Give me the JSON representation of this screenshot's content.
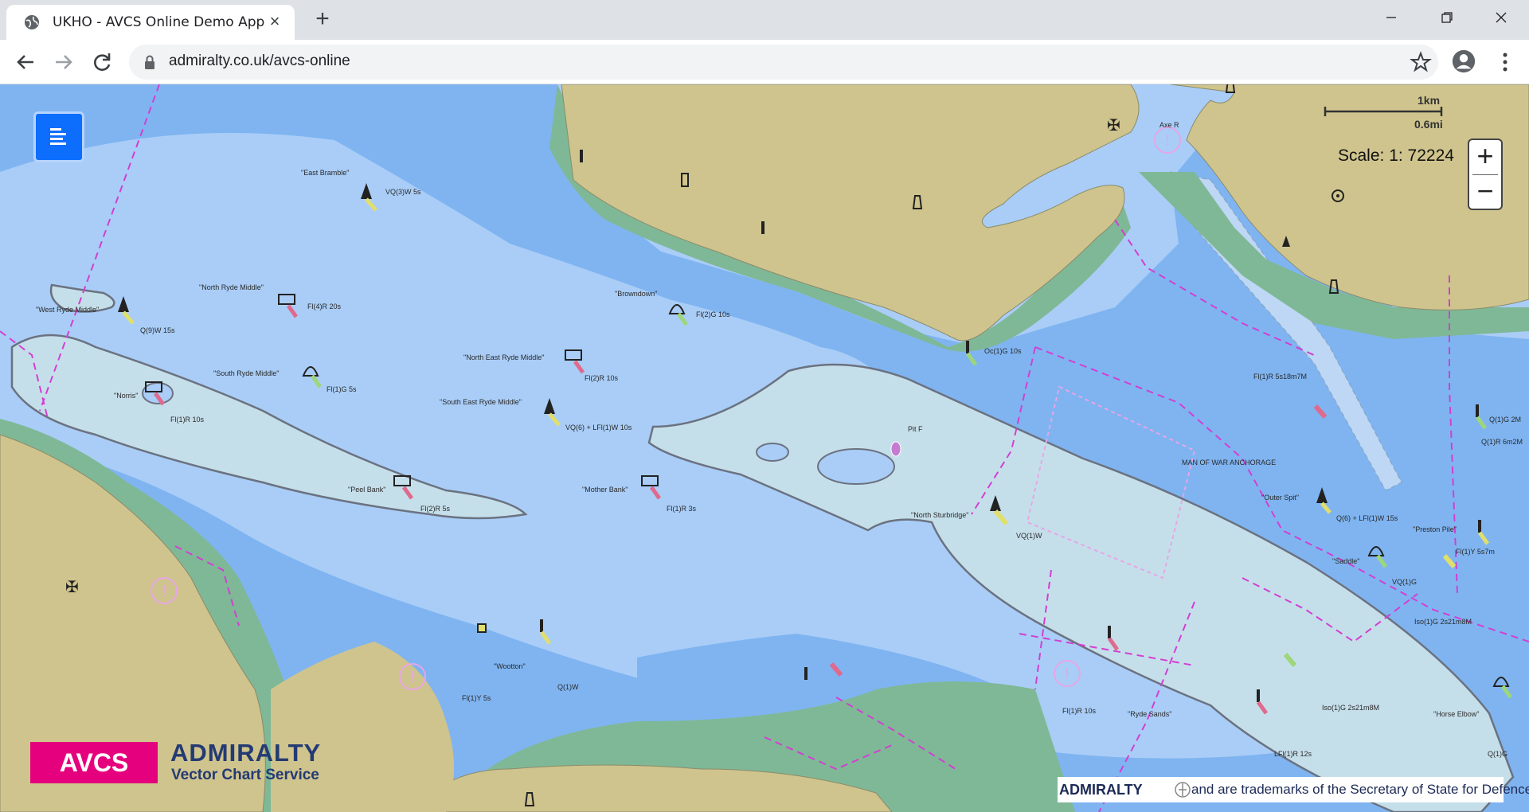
{
  "browser": {
    "tab_title": "UKHO - AVCS Online Demo App",
    "new_tab_label": "+",
    "url": "admiralty.co.uk/avcs-online"
  },
  "map": {
    "scale_text": "Scale: 1: 72224",
    "scalebar_km": "1km",
    "scalebar_mi": "0.6mi",
    "zoom_in_label": "+",
    "zoom_out_label": "−",
    "colors": {
      "deep_water": "#a9cdf7",
      "shallow_water": "#7fb4f1",
      "drying_bank": "#c5dfea",
      "land": "#cfc48d",
      "intertidal": "#7fb896",
      "magenta_boundary": "#d23fd2",
      "red_light": "#e06a8d",
      "green_light": "#9ed67a",
      "yellow_light": "#e0df6c"
    },
    "place_labels": [
      "\"East Bramble\"",
      "VQ(3)W 5s",
      "\"North Ryde Middle\"",
      "Fl(4)R 20s",
      "\"West Ryde Middle\"",
      "Q(9)W 15s",
      "\"Browndown\"",
      "Fl(2)G 10s",
      "\"North East Ryde Middle\"",
      "Fl(2)R 10s",
      "\"South Ryde Middle\"",
      "Fl(1)G 5s",
      "\"Norris\"",
      "Fl(1)R 10s",
      "\"South East Ryde Middle\"",
      "VQ(6) + LFl(1)W 10s",
      "\"Peel Bank\"",
      "Fl(2)R 5s",
      "\"Mother Bank\"",
      "Fl(1)R 3s",
      "Oc(1)G 10s",
      "Pit F",
      "\"North Sturbridge\"",
      "VQ(1)W",
      "MAN OF WAR ANCHORAGE",
      "Fl(1)R 5s18m7M",
      "Q(1)G 2M",
      "Q(1)R 6m2M",
      "\"Outer Spit\"",
      "Q(6) + LFl(1)W 15s",
      "\"Preston Pile\"",
      "Fl(1)Y 5s7m",
      "\"Saddle\"",
      "VQ(1)G",
      "Iso(1)G 2s21m8M",
      "\"Wootton\"",
      "Q(1)W",
      "Fl(1)Y 5s",
      "Fl(1)R 10s",
      "\"Ryde Sands\"",
      "Iso(1)G 2s21m8M",
      "LFl(1)R 12s",
      "\"Horse Elbow\"",
      "Q(1)G",
      "Axe R"
    ]
  },
  "branding": {
    "avcs_logo": "AVCS",
    "admiralty_name": "ADMIRALTY",
    "admiralty_sub": "Vector Chart Service",
    "trademark_bold": "ADMIRALTY",
    "trademark_rest": "and   are trademarks of the Secretary of State for Defence"
  }
}
